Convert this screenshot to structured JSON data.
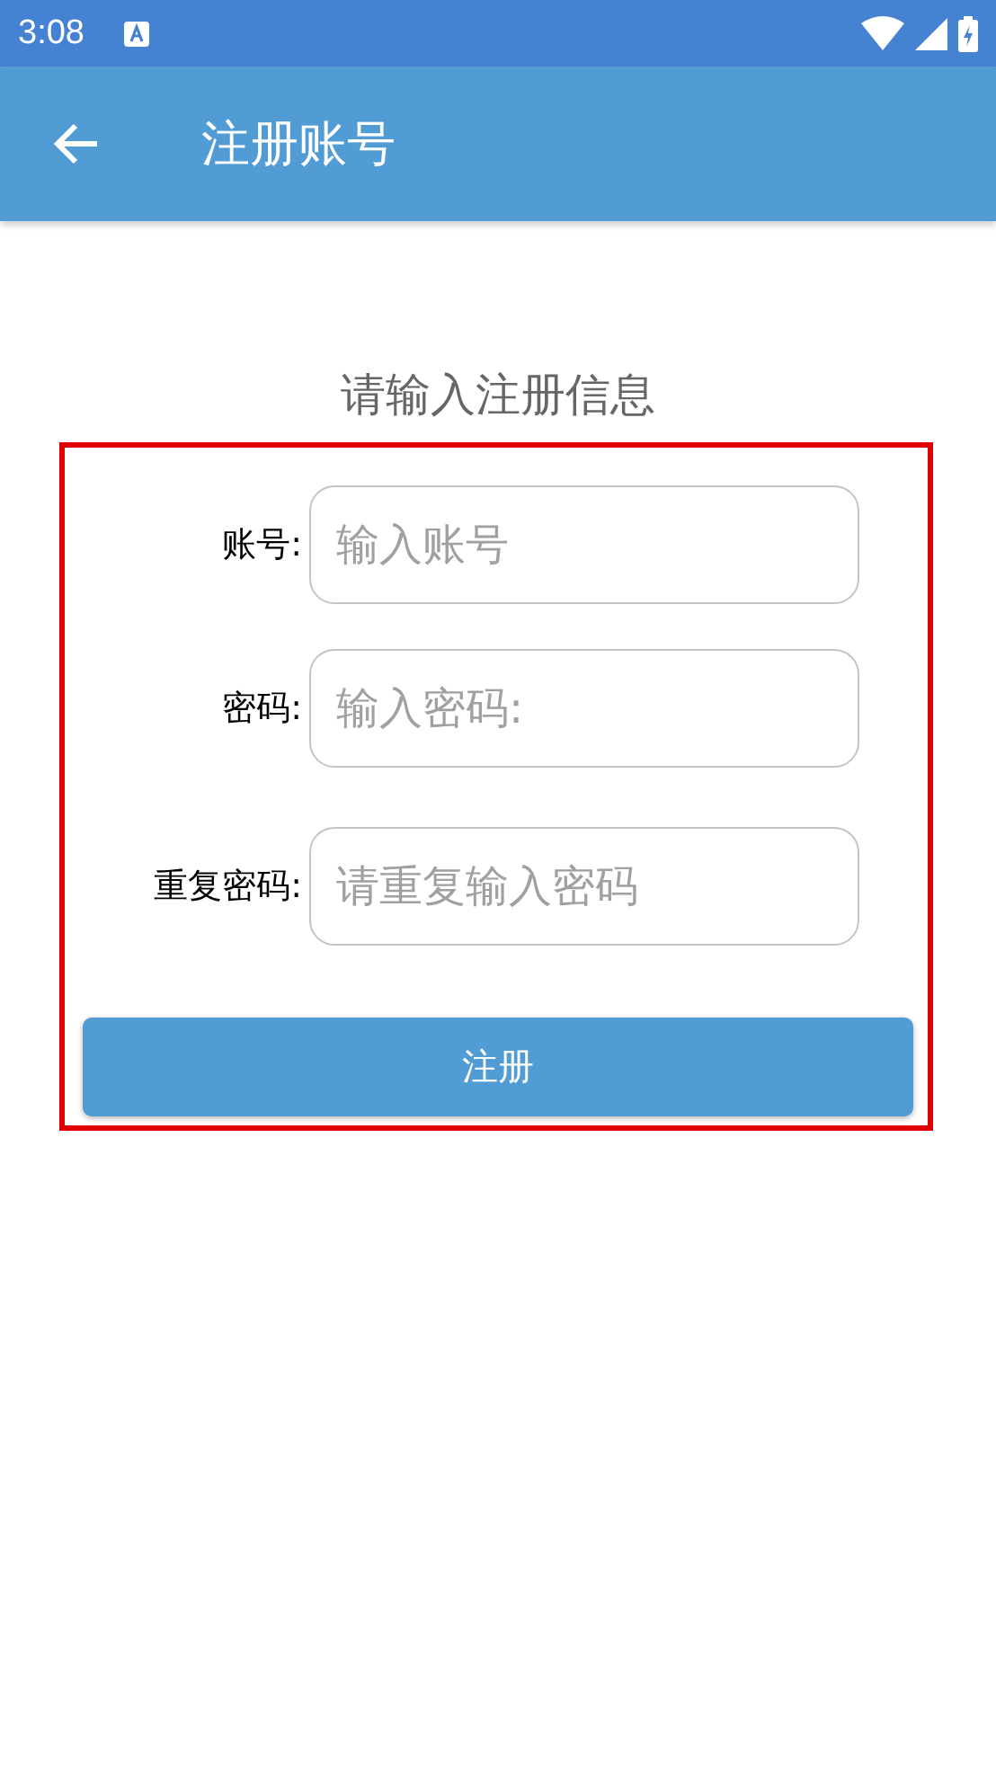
{
  "status_bar": {
    "time": "3:08"
  },
  "app_bar": {
    "title": "注册账号"
  },
  "heading": "请输入注册信息",
  "fields": [
    {
      "label": "账号:",
      "placeholder": "输入账号"
    },
    {
      "label": "密码:",
      "placeholder": "输入密码:"
    },
    {
      "label": "重复密码:",
      "placeholder": "请重复输入密码"
    }
  ],
  "submit_button": "注册"
}
